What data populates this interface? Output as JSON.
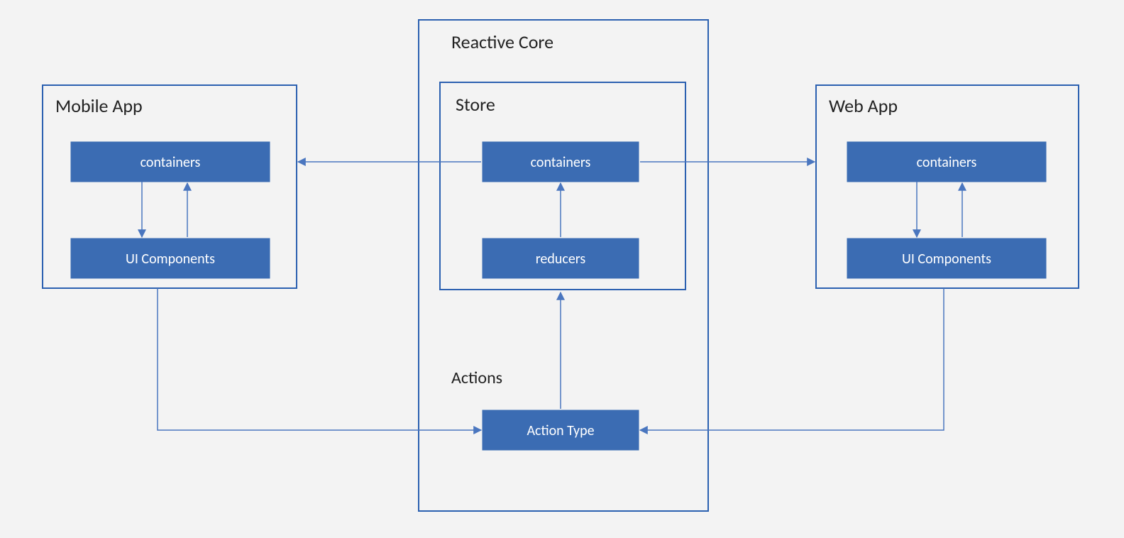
{
  "colors": {
    "background": "#f3f3f3",
    "box_fill": "#3b6cb3",
    "stroke": "#2b60b0",
    "connector": "#4a76bf",
    "text_dark": "#222222",
    "text_light": "#ffffff"
  },
  "mobile": {
    "title": "Mobile App",
    "containers": "containers",
    "ui": "UI Components"
  },
  "core": {
    "title": "Reactive Core",
    "store": {
      "title": "Store",
      "containers": "containers",
      "reducers": "reducers"
    },
    "actions": {
      "title": "Actions",
      "action_type": "Action Type"
    }
  },
  "web": {
    "title": "Web App",
    "containers": "containers",
    "ui": "UI Components"
  }
}
